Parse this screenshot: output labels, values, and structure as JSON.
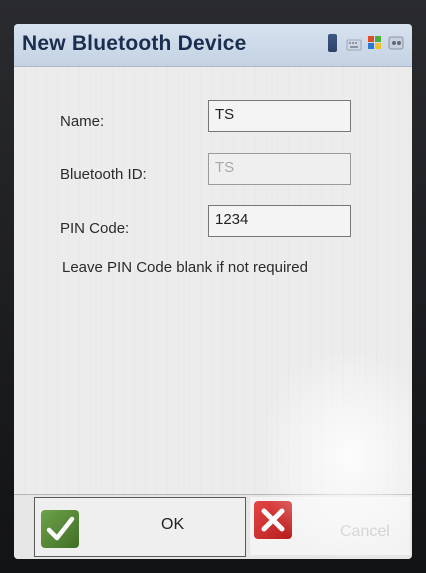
{
  "window": {
    "title": "New Bluetooth Device"
  },
  "status_icons": [
    "battery-icon",
    "keyboard-icon",
    "windows-start-icon",
    "connection-icon"
  ],
  "form": {
    "name": {
      "label": "Name:",
      "value": "TS"
    },
    "bluetooth_id": {
      "label": "Bluetooth ID:",
      "value": "TS"
    },
    "pin_code": {
      "label": "PIN Code:",
      "value": "1234"
    },
    "hint": "Leave PIN Code blank if not required"
  },
  "buttons": {
    "ok_label": "OK",
    "cancel_label": "Cancel"
  },
  "colors": {
    "title_text": "#1a2f4f",
    "titlebar": "#c4d2e3",
    "ok_green": "#4f8a31",
    "cancel_red": "#cc2a2a"
  }
}
